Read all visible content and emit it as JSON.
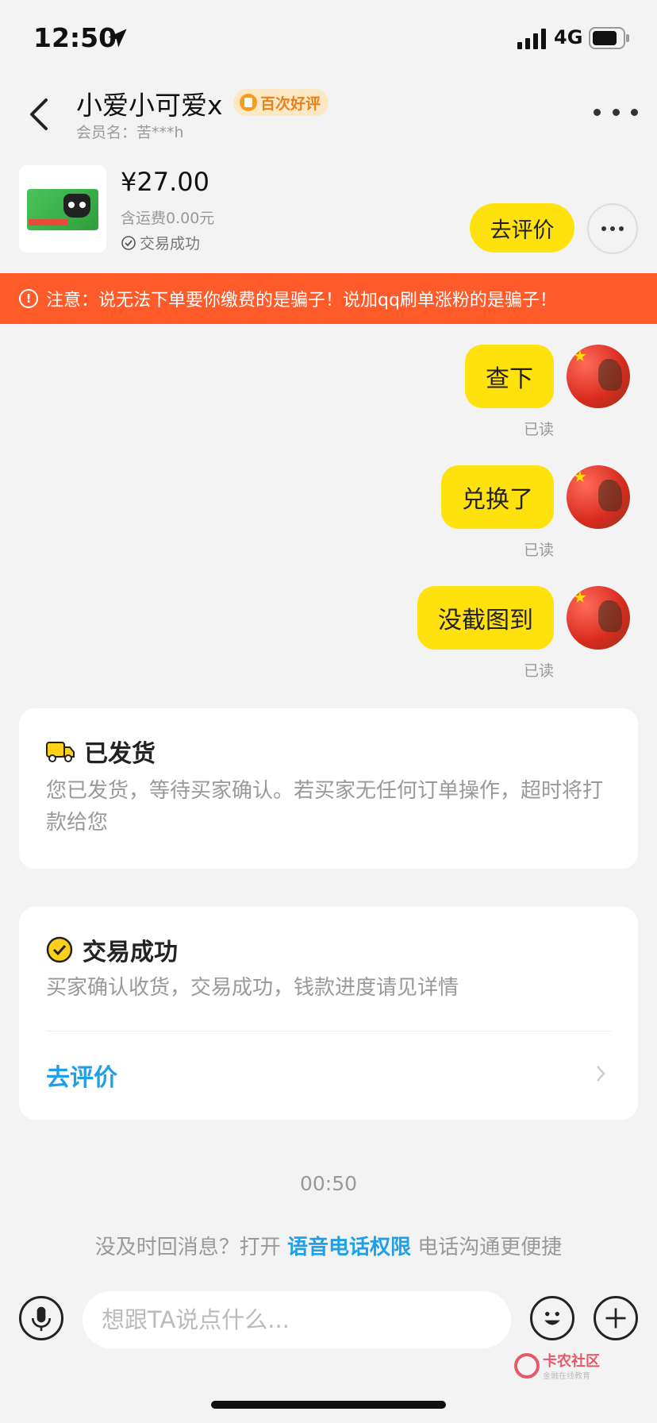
{
  "status_bar": {
    "time": "12:50",
    "network": "4G"
  },
  "header": {
    "seller_name": "小爱小可爱x",
    "badge": "百次好评",
    "member_label": "会员名：苦***h"
  },
  "order": {
    "price": "¥27.00",
    "shipping": "含运费0.00元",
    "status": "交易成功",
    "review_button": "去评价"
  },
  "warning": "注意：说无法下单要你缴费的是骗子！说加qq刷单涨粉的是骗子！",
  "messages": [
    {
      "text": "查下",
      "status": "已读"
    },
    {
      "text": "兑换了",
      "status": "已读"
    },
    {
      "text": "没截图到",
      "status": "已读"
    }
  ],
  "shipped_card": {
    "title": "已发货",
    "desc": "您已发货，等待买家确认。若买家无任何订单操作，超时将打款给您"
  },
  "success_card": {
    "title": "交易成功",
    "desc": "买家确认收货，交易成功，钱款进度请见详情",
    "link": "去评价"
  },
  "timestamp": "00:50",
  "voice_tip": {
    "before": "没及时回消息？打开 ",
    "link": "语音电话权限",
    "after": " 电话沟通更便捷"
  },
  "input": {
    "placeholder": "想跟TA说点什么..."
  },
  "watermark": {
    "title": "卡农社区",
    "sub": "金融在线教育"
  },
  "colors": {
    "accent": "#ffe10e",
    "warning": "#ff5a2a",
    "link": "#1f9fe8"
  }
}
